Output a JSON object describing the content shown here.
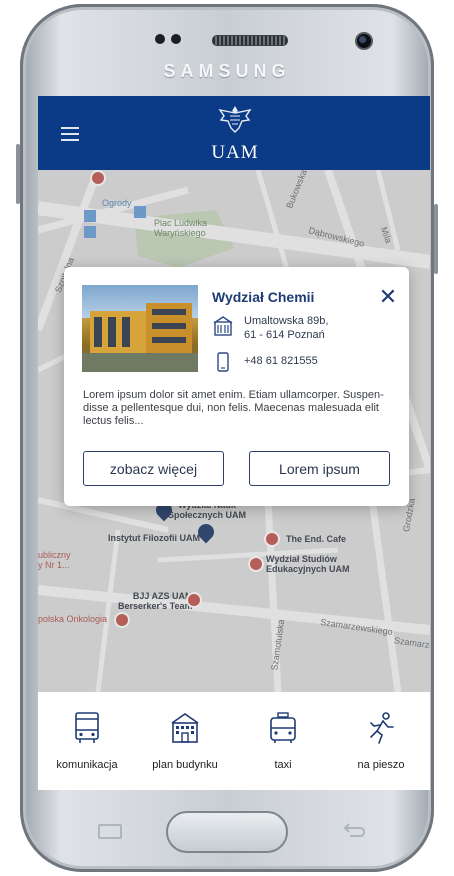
{
  "device": {
    "brand": "SAMSUNG"
  },
  "header": {
    "logo_text": "UAM",
    "menu_icon": "hamburger-icon",
    "background": "#0b3a86"
  },
  "map": {
    "labels": [
      {
        "text": "Ogrody"
      },
      {
        "text": "Plac Ludwika\nWaryńskiego"
      },
      {
        "text": "Dąbrowskiego"
      },
      {
        "text": "Bukowska"
      },
      {
        "text": "Szpitalna"
      },
      {
        "text": "Mila"
      },
      {
        "text": "Wydział Nauk\nSpołecznych UAM"
      },
      {
        "text": "Instytut Filozofii UAM"
      },
      {
        "text": "The End. Cafe"
      },
      {
        "text": "Wydział Studiów\nEdukacyjnych UAM"
      },
      {
        "text": "BJJ AZS UAM\nBerserker's Team"
      },
      {
        "text": "ubliczny\ny Nr 1..."
      },
      {
        "text": "polska Onkologia"
      },
      {
        "text": "Szamarzewskiego"
      },
      {
        "text": "Szamarze"
      },
      {
        "text": "Grodzka"
      },
      {
        "text": "Szamotulska"
      }
    ]
  },
  "popup": {
    "title": "Wydział Chemii",
    "address_line1": "Umaltowska 89b,",
    "address_line2": "61 - 614 Poznań",
    "phone": "+48 61 821555",
    "description": "Lorem ipsum dolor sit amet enim. Etiam ullamcorper. Suspen-disse a pellentesque dui, non felis. Maecenas malesuada elit lectus felis...",
    "button_more": "zobacz więcej",
    "button_other": "Lorem ipsum",
    "accent": "#1f3b73"
  },
  "tabs": [
    {
      "label": "komunikacja",
      "icon": "bus-icon"
    },
    {
      "label": "plan budynku",
      "icon": "building-icon"
    },
    {
      "label": "taxi",
      "icon": "taxi-icon"
    },
    {
      "label": "na pieszo",
      "icon": "walking-icon"
    }
  ]
}
